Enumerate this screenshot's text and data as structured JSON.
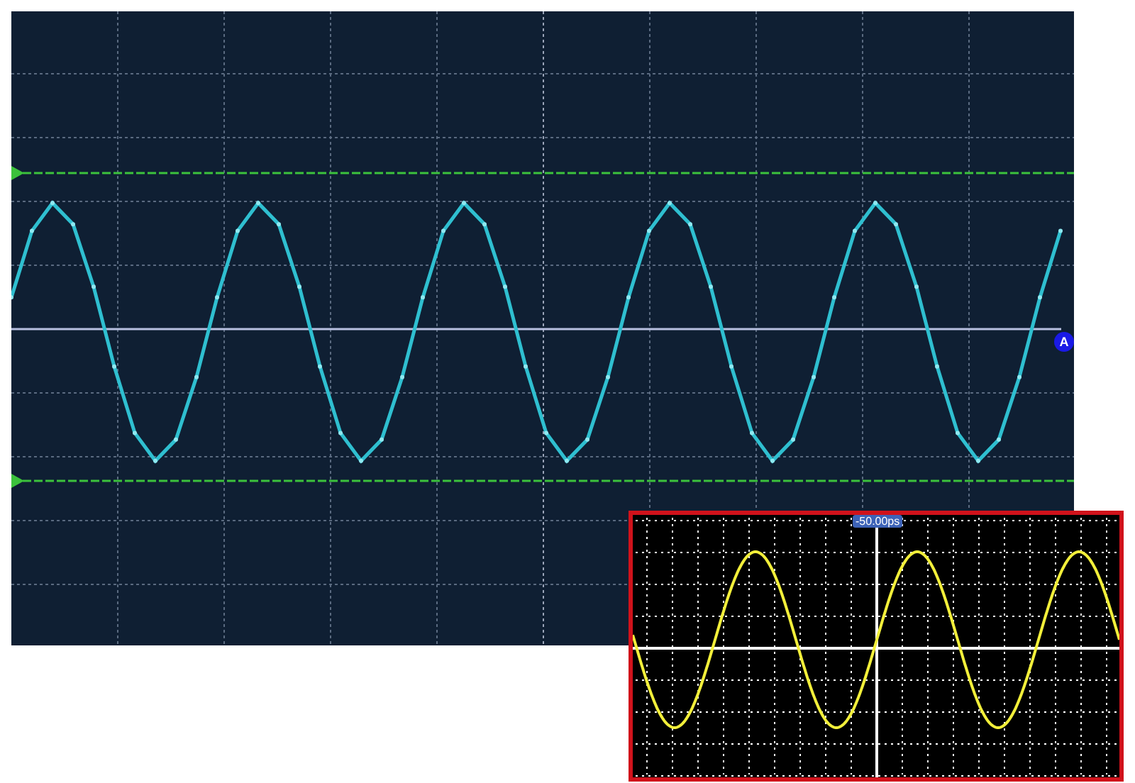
{
  "main_display": {
    "channel_marker": "A"
  },
  "inset_display": {
    "time_label": "-50.00ps"
  }
}
